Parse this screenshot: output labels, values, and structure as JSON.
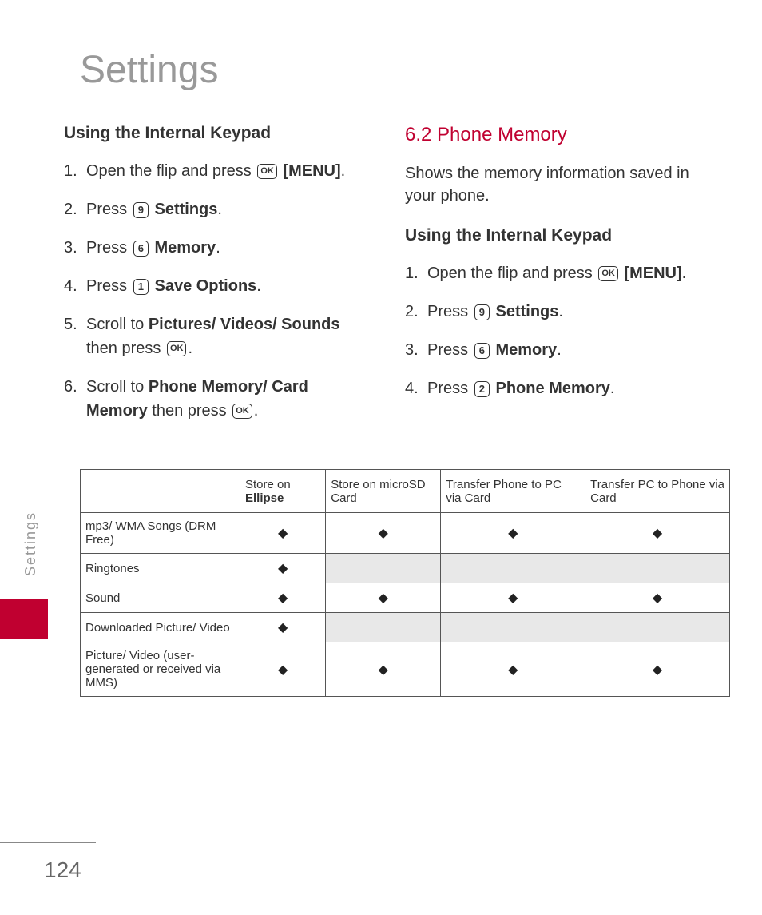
{
  "title": "Settings",
  "sideLabel": "Settings",
  "pageNumber": "124",
  "left": {
    "subHeading": "Using the Internal Keypad",
    "steps": [
      {
        "num": "1.",
        "pre": "Open the flip and press ",
        "key": "OK",
        "post": " ",
        "bold": "[MENU]",
        "after": "."
      },
      {
        "num": "2.",
        "pre": "Press ",
        "key": "9",
        "post": " ",
        "bold": "Settings",
        "after": "."
      },
      {
        "num": "3.",
        "pre": "Press ",
        "key": "6",
        "post": " ",
        "bold": "Memory",
        "after": "."
      },
      {
        "num": "4.",
        "pre": "Press ",
        "key": "1",
        "post": " ",
        "bold": "Save Options",
        "after": "."
      },
      {
        "num": "5.",
        "pre": "Scroll to ",
        "bold": "Pictures/ Videos/ Sounds",
        "mid": " then press ",
        "key": "OK",
        "after": "."
      },
      {
        "num": "6.",
        "pre": "Scroll to ",
        "bold": "Phone Memory/ Card Memory",
        "mid": " then press ",
        "key": "OK",
        "after": "."
      }
    ]
  },
  "right": {
    "sectionHeading": "6.2 Phone Memory",
    "desc": "Shows the memory information saved in your phone.",
    "subHeading": "Using the Internal Keypad",
    "steps": [
      {
        "num": "1.",
        "pre": "Open the flip and press ",
        "key": "OK",
        "post": " ",
        "bold": "[MENU]",
        "after": "."
      },
      {
        "num": "2.",
        "pre": "Press ",
        "key": "9",
        "post": " ",
        "bold": "Settings",
        "after": "."
      },
      {
        "num": "3.",
        "pre": "Press ",
        "key": "6",
        "post": " ",
        "bold": "Memory",
        "after": "."
      },
      {
        "num": "4.",
        "pre": "Press ",
        "key": "2",
        "post": " ",
        "bold": "Phone Memory",
        "after": "."
      }
    ]
  },
  "table": {
    "headers": [
      "",
      "Store on |Ellipse",
      "Store on microSD Card",
      "Transfer Phone to PC via Card",
      "Transfer PC to Phone via Card"
    ],
    "rows": [
      {
        "label": "mp3/ WMA Songs (DRM Free)",
        "cells": [
          "◆",
          "◆",
          "◆",
          "◆"
        ],
        "shaded": [
          false,
          false,
          false,
          false
        ]
      },
      {
        "label": "Ringtones",
        "cells": [
          "◆",
          "",
          "",
          ""
        ],
        "shaded": [
          false,
          true,
          true,
          true
        ]
      },
      {
        "label": "Sound",
        "cells": [
          "◆",
          "◆",
          "◆",
          "◆"
        ],
        "shaded": [
          false,
          false,
          false,
          false
        ]
      },
      {
        "label": "Downloaded Picture/ Video",
        "cells": [
          "◆",
          "",
          "",
          ""
        ],
        "shaded": [
          false,
          true,
          true,
          true
        ]
      },
      {
        "label": "Picture/ Video (user-generated or received via MMS)",
        "cells": [
          "◆",
          "◆",
          "◆",
          "◆"
        ],
        "shaded": [
          false,
          false,
          false,
          false
        ]
      }
    ]
  },
  "chart_data": {
    "type": "table",
    "title": "Storage and Transfer Capabilities",
    "columns": [
      "Store on Ellipse",
      "Store on microSD Card",
      "Transfer Phone to PC via Card",
      "Transfer PC to Phone via Card"
    ],
    "rows": [
      {
        "category": "mp3/ WMA Songs (DRM Free)",
        "values": [
          true,
          true,
          true,
          true
        ]
      },
      {
        "category": "Ringtones",
        "values": [
          true,
          false,
          false,
          false
        ]
      },
      {
        "category": "Sound",
        "values": [
          true,
          true,
          true,
          true
        ]
      },
      {
        "category": "Downloaded Picture/ Video",
        "values": [
          true,
          false,
          false,
          false
        ]
      },
      {
        "category": "Picture/ Video (user-generated or received via MMS)",
        "values": [
          true,
          true,
          true,
          true
        ]
      }
    ]
  }
}
